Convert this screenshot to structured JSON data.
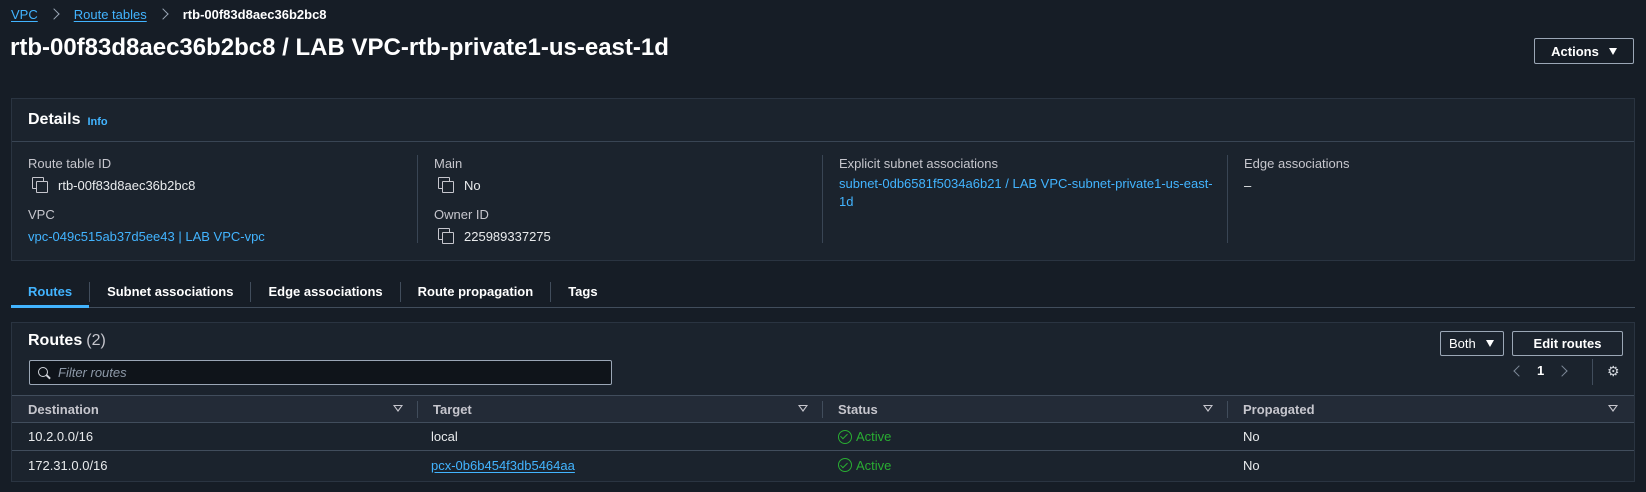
{
  "breadcrumb": {
    "items": [
      "VPC",
      "Route tables"
    ],
    "current": "rtb-00f83d8aec36b2bc8"
  },
  "page": {
    "title": "rtb-00f83d8aec36b2bc8 / LAB VPC-rtb-private1-us-east-1d",
    "actions_label": "Actions"
  },
  "details": {
    "title": "Details",
    "info_label": "Info",
    "route_table_id_label": "Route table ID",
    "route_table_id": "rtb-00f83d8aec36b2bc8",
    "vpc_label": "VPC",
    "vpc_value": "vpc-049c515ab37d5ee43 | LAB VPC-vpc",
    "main_label": "Main",
    "main_value": "No",
    "owner_label": "Owner ID",
    "owner_value": "225989337275",
    "explicit_label": "Explicit subnet associations",
    "explicit_value": "subnet-0db6581f5034a6b21 / LAB VPC-subnet-private1-us-east-1d",
    "edge_label": "Edge associations",
    "edge_value": "–"
  },
  "tabs": [
    {
      "label": "Routes",
      "active": true
    },
    {
      "label": "Subnet associations",
      "active": false
    },
    {
      "label": "Edge associations",
      "active": false
    },
    {
      "label": "Route propagation",
      "active": false
    },
    {
      "label": "Tags",
      "active": false
    }
  ],
  "routes": {
    "title": "Routes",
    "count": "(2)",
    "filter_select": "Both",
    "edit_label": "Edit routes",
    "filter_placeholder": "Filter routes",
    "page": "1",
    "columns": [
      "Destination",
      "Target",
      "Status",
      "Propagated"
    ],
    "rows": [
      {
        "destination": "10.2.0.0/16",
        "target": "local",
        "target_is_link": false,
        "status": "Active",
        "propagated": "No"
      },
      {
        "destination": "172.31.0.0/16",
        "target": "pcx-0b6b454f3db5464aa",
        "target_is_link": true,
        "status": "Active",
        "propagated": "No"
      }
    ]
  },
  "colors": {
    "background": "#161d26",
    "panel": "#1b232d",
    "link": "#42b4ff",
    "success": "#29ad32"
  }
}
